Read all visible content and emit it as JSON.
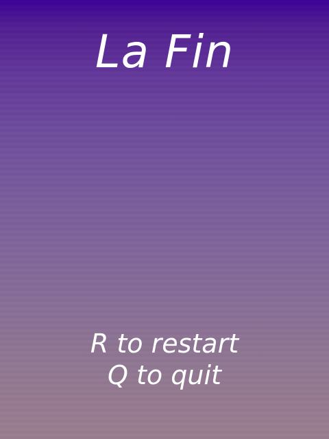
{
  "screen": {
    "title": "La Fin",
    "restart_prompt": "R to restart",
    "quit_prompt": "Q to quit"
  },
  "colors": {
    "gradient_top": "#3c0096",
    "gradient_bottom": "#9a7e8f",
    "text": "#ffffff"
  }
}
